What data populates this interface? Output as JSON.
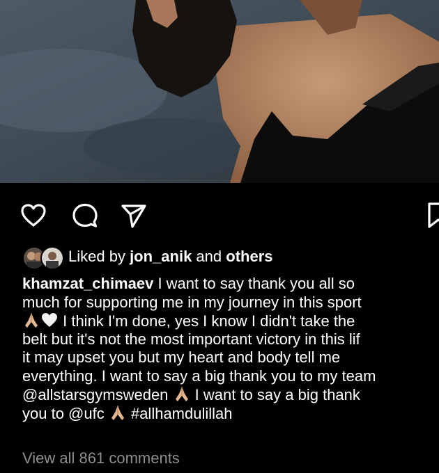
{
  "post": {
    "liked": {
      "prefix": "Liked by ",
      "user": "jon_anik",
      "middle": " and ",
      "others": "others"
    },
    "caption": {
      "username": "khamzat_chimaev",
      "line1": " I want to say thank you all so",
      "line2": "much for supporting me in my journey in this sport",
      "line3": " I think I'm done, yes I know I didn't take the",
      "line4": "belt but it's not the most important victory in this lif",
      "line5": "it may upset you but my heart and body tell me",
      "line6": "everything. I want to say a big thank you to my team",
      "line7a": "@allstarsgymsweden ",
      "line7b": "  I want to say a big thank",
      "line8a": "you to @ufc ",
      "line8b": " #allhamdulillah"
    },
    "view_comments": "View all 861 comments"
  },
  "icons": {
    "like": "heart-icon",
    "comment": "comment-bubble-icon",
    "share": "paper-plane-icon",
    "save": "bookmark-icon",
    "emojis": [
      "folded-hands-icon",
      "white-heart-icon"
    ]
  },
  "colors": {
    "background": "#000000",
    "text": "#ffffff",
    "muted": "#8e8e8e"
  }
}
